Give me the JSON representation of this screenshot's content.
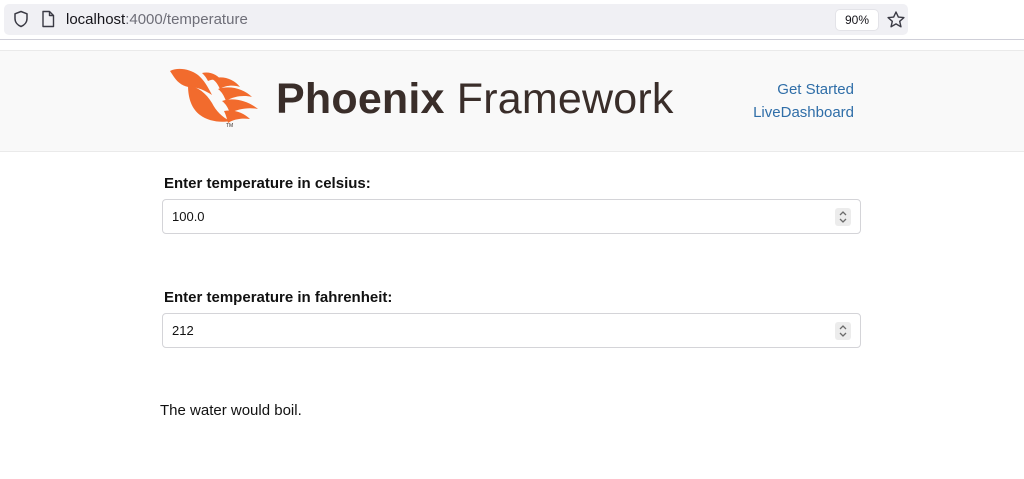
{
  "browser": {
    "url_host": "localhost",
    "url_path": ":4000/temperature",
    "zoom": "90%"
  },
  "header": {
    "logo_word_bold": "Phoenix",
    "logo_word_light": " Framework",
    "nav": {
      "get_started": "Get Started",
      "live_dashboard": "LiveDashboard"
    },
    "brand_color": "#f26b2d",
    "link_color": "#2f6ea8"
  },
  "form": {
    "celsius_label": "Enter temperature in celsius:",
    "celsius_value": "100.0",
    "fahrenheit_label": "Enter temperature in fahrenheit:",
    "fahrenheit_value": "212"
  },
  "result_message": "The water would boil."
}
